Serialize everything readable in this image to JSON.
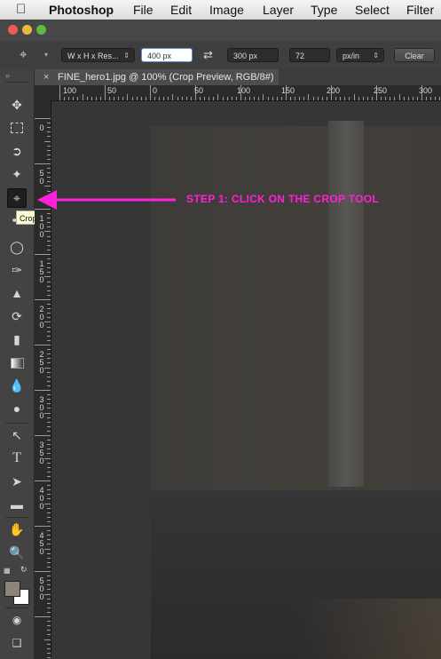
{
  "menubar": {
    "app_name": "Photoshop",
    "items": [
      "File",
      "Edit",
      "Image",
      "Layer",
      "Type",
      "Select",
      "Filter"
    ]
  },
  "options_bar": {
    "preset_label": "W x H x Res...",
    "width_value": "400 px",
    "height_value": "300 px",
    "resolution_value": "72",
    "resolution_unit": "px/in",
    "clear_label": "Clear"
  },
  "document": {
    "tab_title": "FINE_hero1.jpg @ 100% (Crop Preview, RGB/8#)",
    "hruler_labels": [
      "100",
      "50",
      "0",
      "50",
      "100",
      "150",
      "200",
      "250",
      "300"
    ],
    "vruler_labels": [
      [
        "0"
      ],
      [
        "5",
        "0"
      ],
      [
        "1",
        "0",
        "0"
      ],
      [
        "1",
        "5",
        "0"
      ],
      [
        "2",
        "0",
        "0"
      ],
      [
        "2",
        "5",
        "0"
      ],
      [
        "3",
        "0",
        "0"
      ],
      [
        "3",
        "5",
        "0"
      ],
      [
        "4",
        "0",
        "0"
      ],
      [
        "4",
        "5",
        "0"
      ],
      [
        "5",
        "0",
        "0"
      ]
    ]
  },
  "annotation": {
    "text": "STEP 1: CLICK ON THE CROP TOOL",
    "color": "#ff21d8"
  },
  "tooltip": {
    "text": "Crop Tool (C)"
  },
  "tools": [
    "move-icon",
    "marquee-icon",
    "lasso-icon",
    "magic-wand-icon",
    "crop-icon",
    "eyedropper-icon",
    "healing-brush-icon",
    "brush-icon",
    "clone-stamp-icon",
    "history-brush-icon",
    "eraser-icon",
    "gradient-icon",
    "blur-icon",
    "dodge-icon",
    "pen-icon",
    "type-icon",
    "path-selection-icon",
    "rectangle-icon",
    "hand-icon",
    "zoom-icon"
  ]
}
